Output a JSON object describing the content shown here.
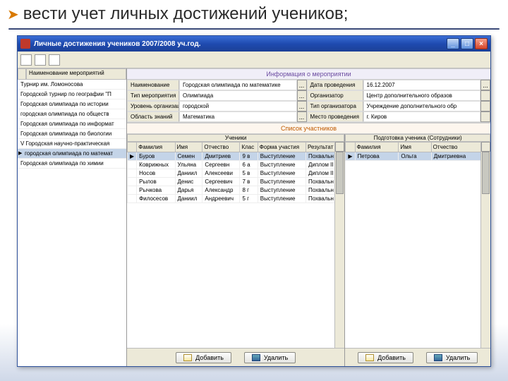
{
  "slide": {
    "bullet_glyph": "➤",
    "title": "вести учет личных достижений учеников;"
  },
  "window": {
    "title": "Личные достижения учеников 2007/2008 уч.год.",
    "buttons": {
      "min": "_",
      "max": "□",
      "close": "×"
    }
  },
  "left": {
    "column_header": "Наименование мероприятий",
    "events": [
      "Турнир им. Ломоносова",
      "Городской турнир по географии \"П",
      "Городская олимпиада по истории",
      "городская олимпиада по обществ",
      "Городская олимпиада по информат",
      "Городская олимпиада по биологии",
      "V Городская научно-практическая",
      "городская олимпиада по математ",
      "Городская олимпиада по химии"
    ],
    "selected_index": 7
  },
  "info": {
    "section_title": "Информация о мероприятии",
    "rows": [
      [
        "Наименование",
        "Городская олимпиада по математике",
        "...",
        "Дата проведения",
        "16.12.2007",
        "..."
      ],
      [
        "Тип мероприятия",
        "Олимпиада",
        "...",
        "Организатор",
        "Центр дополнительного образов",
        ""
      ],
      [
        "Уровень организации",
        "городской",
        "...",
        "Тип организатора",
        "Учреждение дополнительного обр",
        ""
      ],
      [
        "Область знаний",
        "Математика",
        "...",
        "Место проведения",
        "г. Киров",
        ""
      ]
    ]
  },
  "participants": {
    "section_title": "Список участников",
    "students_header": "Ученики",
    "teachers_header": "Подготовка ученика (Сотрудники)",
    "student_cols": [
      "Фамилия",
      "Имя",
      "Отчество",
      "Клас",
      "Форма участия",
      "Результат"
    ],
    "teacher_cols": [
      "Фамилия",
      "Имя",
      "Отчество"
    ],
    "students": [
      [
        "Буров",
        "Семен",
        "Дмитриев",
        "9 в",
        "Выступление",
        "Похвальн"
      ],
      [
        "Коврижных",
        "Ульяна",
        "Сергеевн",
        "6 а",
        "Выступление",
        "Диплом II"
      ],
      [
        "Носов",
        "Даниил",
        "Алексееви",
        "5 в",
        "Выступление",
        "Диплом II с"
      ],
      [
        "Рылов",
        "Денис",
        "Сергеевич",
        "7 в",
        "Выступление",
        "Похвальн"
      ],
      [
        "Рычкова",
        "Дарья",
        "Александр",
        "8 г",
        "Выступление",
        "Похвальн"
      ],
      [
        "Филосесов",
        "Даниил",
        "Андреевич",
        "5 г",
        "Выступление",
        "Похвальн"
      ]
    ],
    "teachers": [
      [
        "Петрова",
        "Ольга",
        "Дмитриевна"
      ]
    ]
  },
  "buttons": {
    "add": "Добавить",
    "del": "Удалить"
  }
}
